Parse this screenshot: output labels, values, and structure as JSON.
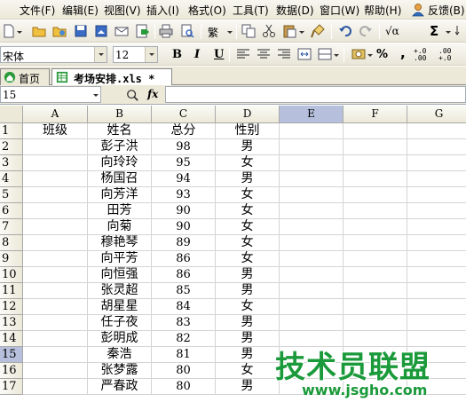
{
  "menu": {
    "items": [
      "文件(F)",
      "编辑(E)",
      "视图(V)",
      "插入(I)",
      "格式(O)",
      "工具(T)",
      "数据(D)",
      "窗口(W)",
      "帮助(H)"
    ],
    "feedback": "反馈(B)"
  },
  "toolbar": {
    "font_name": "宋体",
    "font_size": "12",
    "bold_label": "B",
    "italic_label": "I",
    "underline_label": "U",
    "percent_label": "%",
    "comma_label": ",",
    "sigma_label": "Σ",
    "sqrt_label": "√α",
    "inc_decimal_label": "+.0 .00",
    "dec_decimal_label": ".00 +.0",
    "traditional_label": "繁"
  },
  "tabs": {
    "home": "首页",
    "file": "考场安排.xls *"
  },
  "formula_bar": {
    "name_box": "15",
    "fx_label": "fx",
    "value": ""
  },
  "sheet": {
    "columns": [
      "A",
      "B",
      "C",
      "D",
      "E",
      "F",
      "G"
    ],
    "active_column": "E",
    "active_row": "15",
    "rows": [
      {
        "n": "1",
        "a": "班级",
        "b": "姓名",
        "c": "总分",
        "d": "性别"
      },
      {
        "n": "2",
        "a": "",
        "b": "彭子洪",
        "c": "98",
        "d": "男"
      },
      {
        "n": "3",
        "a": "",
        "b": "向玲玲",
        "c": "95",
        "d": "女"
      },
      {
        "n": "4",
        "a": "",
        "b": "杨国召",
        "c": "94",
        "d": "男"
      },
      {
        "n": "5",
        "a": "",
        "b": "向芳洋",
        "c": "93",
        "d": "女"
      },
      {
        "n": "6",
        "a": "",
        "b": "田芳",
        "c": "90",
        "d": "女"
      },
      {
        "n": "7",
        "a": "",
        "b": "向菊",
        "c": "90",
        "d": "女"
      },
      {
        "n": "8",
        "a": "",
        "b": "穆艳琴",
        "c": "89",
        "d": "女"
      },
      {
        "n": "9",
        "a": "",
        "b": "向平芳",
        "c": "86",
        "d": "女"
      },
      {
        "n": "10",
        "a": "",
        "b": "向恒强",
        "c": "86",
        "d": "男"
      },
      {
        "n": "11",
        "a": "",
        "b": "张灵超",
        "c": "85",
        "d": "男"
      },
      {
        "n": "12",
        "a": "",
        "b": "胡星星",
        "c": "84",
        "d": "女"
      },
      {
        "n": "13",
        "a": "",
        "b": "任子夜",
        "c": "83",
        "d": "男"
      },
      {
        "n": "14",
        "a": "",
        "b": "彭明成",
        "c": "82",
        "d": "男"
      },
      {
        "n": "15",
        "a": "",
        "b": "秦浩",
        "c": "81",
        "d": "男"
      },
      {
        "n": "16",
        "a": "",
        "b": "张梦露",
        "c": "80",
        "d": "女"
      },
      {
        "n": "17",
        "a": "",
        "b": "严春政",
        "c": "80",
        "d": "男"
      }
    ]
  },
  "watermark": {
    "title": "技术员联盟",
    "url": "www.jsgho.com"
  },
  "colors": {
    "accent_active": "#b6c0dc",
    "watermark_green": "#1a9a3a",
    "toolbar_bg": "#ece9d8"
  }
}
